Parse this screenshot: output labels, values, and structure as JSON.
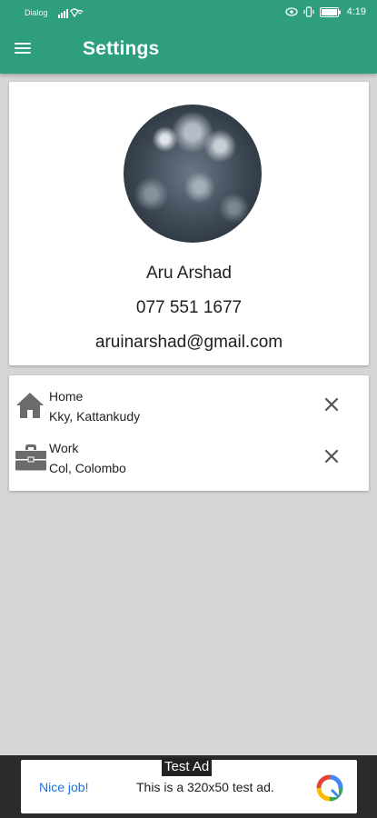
{
  "status_bar": {
    "carrier": "Dialog",
    "time": "4:19"
  },
  "app_bar": {
    "title": "Settings",
    "menu_icon": "hamburger-menu-icon"
  },
  "profile": {
    "name": "Aru Arshad",
    "phone": "077 551 1677",
    "email": "aruinarshad@gmail.com"
  },
  "addresses": [
    {
      "icon": "home-icon",
      "label": "Home",
      "value": "Kky, Kattankudy"
    },
    {
      "icon": "briefcase-icon",
      "label": "Work",
      "value": "Col, Colombo"
    }
  ],
  "ad": {
    "tag": "Test Ad",
    "cta": "Nice job!",
    "text": "This is a 320x50 test ad."
  },
  "colors": {
    "primary": "#2e9e7e",
    "background": "#d6d6d6",
    "icon": "#6b6b6b"
  }
}
